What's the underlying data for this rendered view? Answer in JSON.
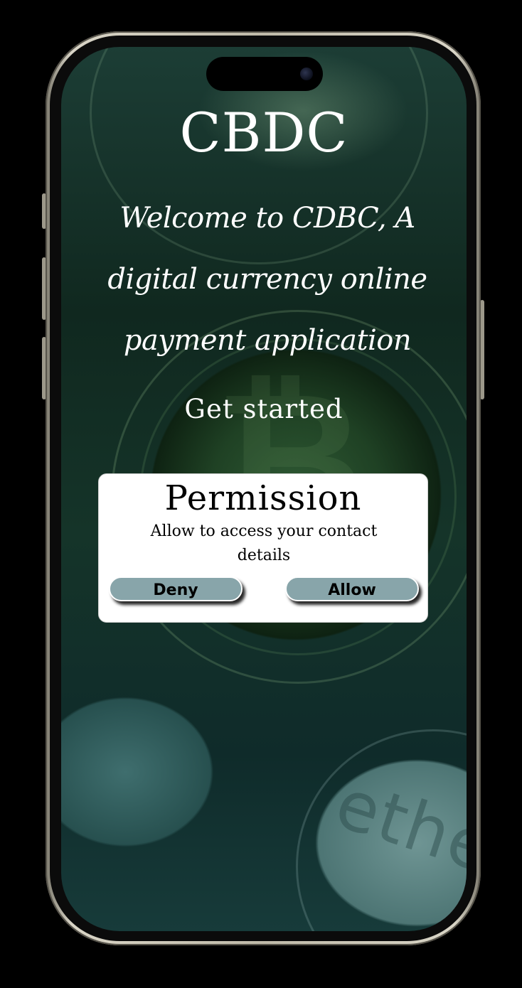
{
  "app": {
    "title": "CBDC",
    "welcome_text": "Welcome to CDBC, A  digital currency online payment application",
    "get_started_label": "Get started"
  },
  "permission_dialog": {
    "title": "Permission",
    "message": "Allow to access your contact details",
    "deny_label": "Deny",
    "allow_label": "Allow"
  },
  "background": {
    "coin_symbol": "₿",
    "coin_engraving": "ethe"
  },
  "colors": {
    "button_fill": "#88a5aa",
    "dialog_background": "#ffffff",
    "text_primary": "#ffffff"
  }
}
